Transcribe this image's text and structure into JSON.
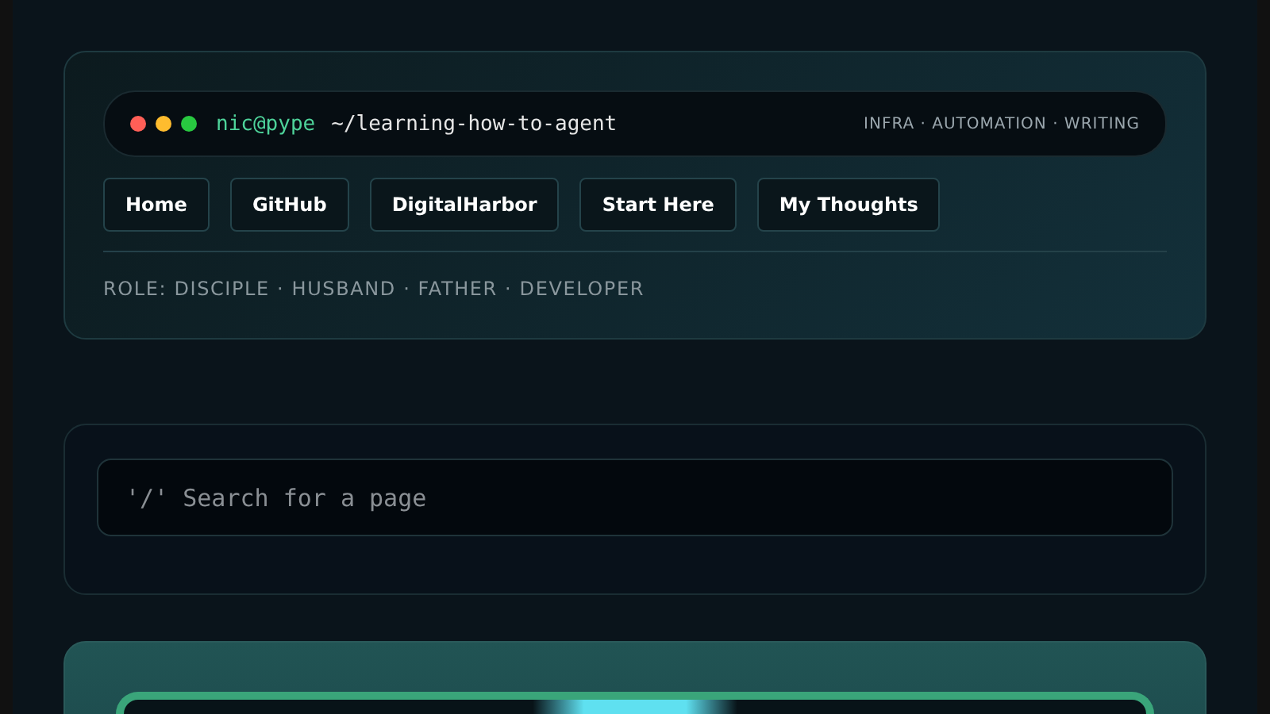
{
  "header": {
    "prompt_user": "nic@pype",
    "prompt_path": "~/learning-how-to-agent",
    "tagline": "INFRA · AUTOMATION · WRITING",
    "nav": [
      "Home",
      "GitHub",
      "DigitalHarbor",
      "Start Here",
      "My Thoughts"
    ],
    "role": "ROLE: DISCIPLE · HUSBAND · FATHER · DEVELOPER"
  },
  "search": {
    "placeholder": "'/' Search for a page"
  }
}
